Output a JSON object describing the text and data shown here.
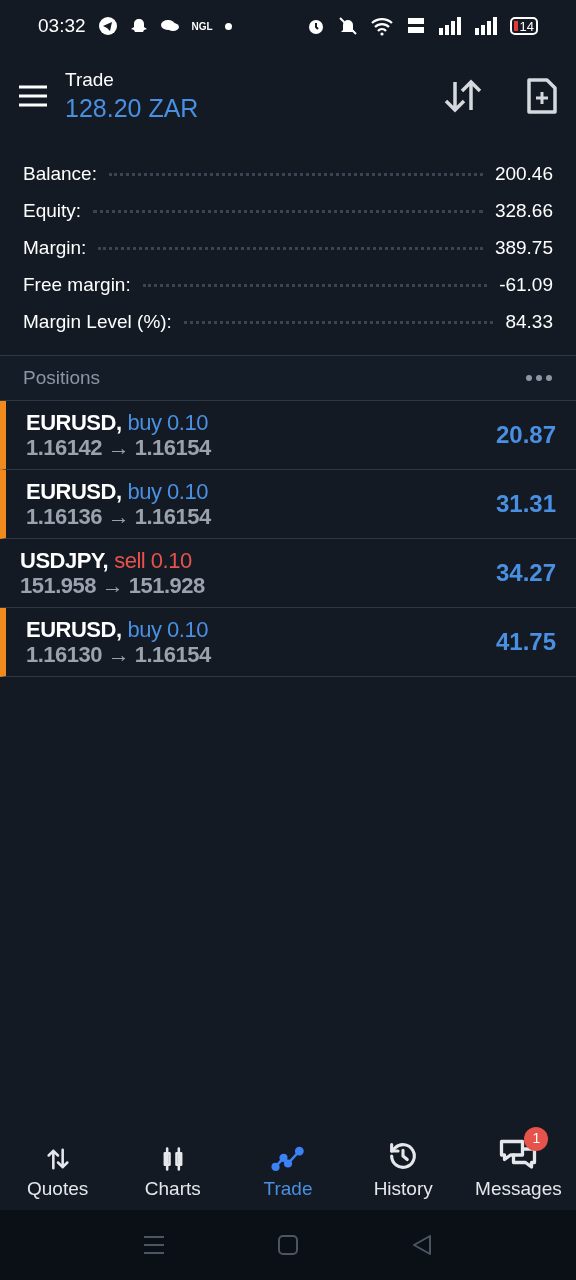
{
  "status_bar": {
    "time": "03:32",
    "app_label": "NGL",
    "battery": "14"
  },
  "header": {
    "title": "Trade",
    "subtitle": "128.20 ZAR"
  },
  "summary": [
    {
      "label": "Balance:",
      "value": "200.46"
    },
    {
      "label": "Equity:",
      "value": "328.66"
    },
    {
      "label": "Margin:",
      "value": "389.75"
    },
    {
      "label": "Free margin:",
      "value": "-61.09"
    },
    {
      "label": "Margin Level (%):",
      "value": "84.33"
    }
  ],
  "positions_header": {
    "title": "Positions"
  },
  "positions": [
    {
      "symbol": "EURUSD,",
      "kind": "buy",
      "order": "buy 0.10",
      "prices": "1.16142 → 1.16154",
      "profit": "20.87",
      "flagged": true
    },
    {
      "symbol": "EURUSD,",
      "kind": "buy",
      "order": "buy 0.10",
      "prices": "1.16136 → 1.16154",
      "profit": "31.31",
      "flagged": true
    },
    {
      "symbol": "USDJPY,",
      "kind": "sell",
      "order": "sell 0.10",
      "prices": "151.958 → 151.928",
      "profit": "34.27",
      "flagged": false
    },
    {
      "symbol": "EURUSD,",
      "kind": "buy",
      "order": "buy 0.10",
      "prices": "1.16130 → 1.16154",
      "profit": "41.75",
      "flagged": true
    }
  ],
  "bottom_nav": [
    {
      "label": "Quotes",
      "kind": "quotes",
      "selected": false
    },
    {
      "label": "Charts",
      "kind": "charts",
      "selected": false
    },
    {
      "label": "Trade",
      "kind": "trade",
      "selected": true
    },
    {
      "label": "History",
      "kind": "history",
      "selected": false
    },
    {
      "label": "Messages",
      "kind": "messages",
      "selected": false,
      "badge": "1"
    }
  ]
}
